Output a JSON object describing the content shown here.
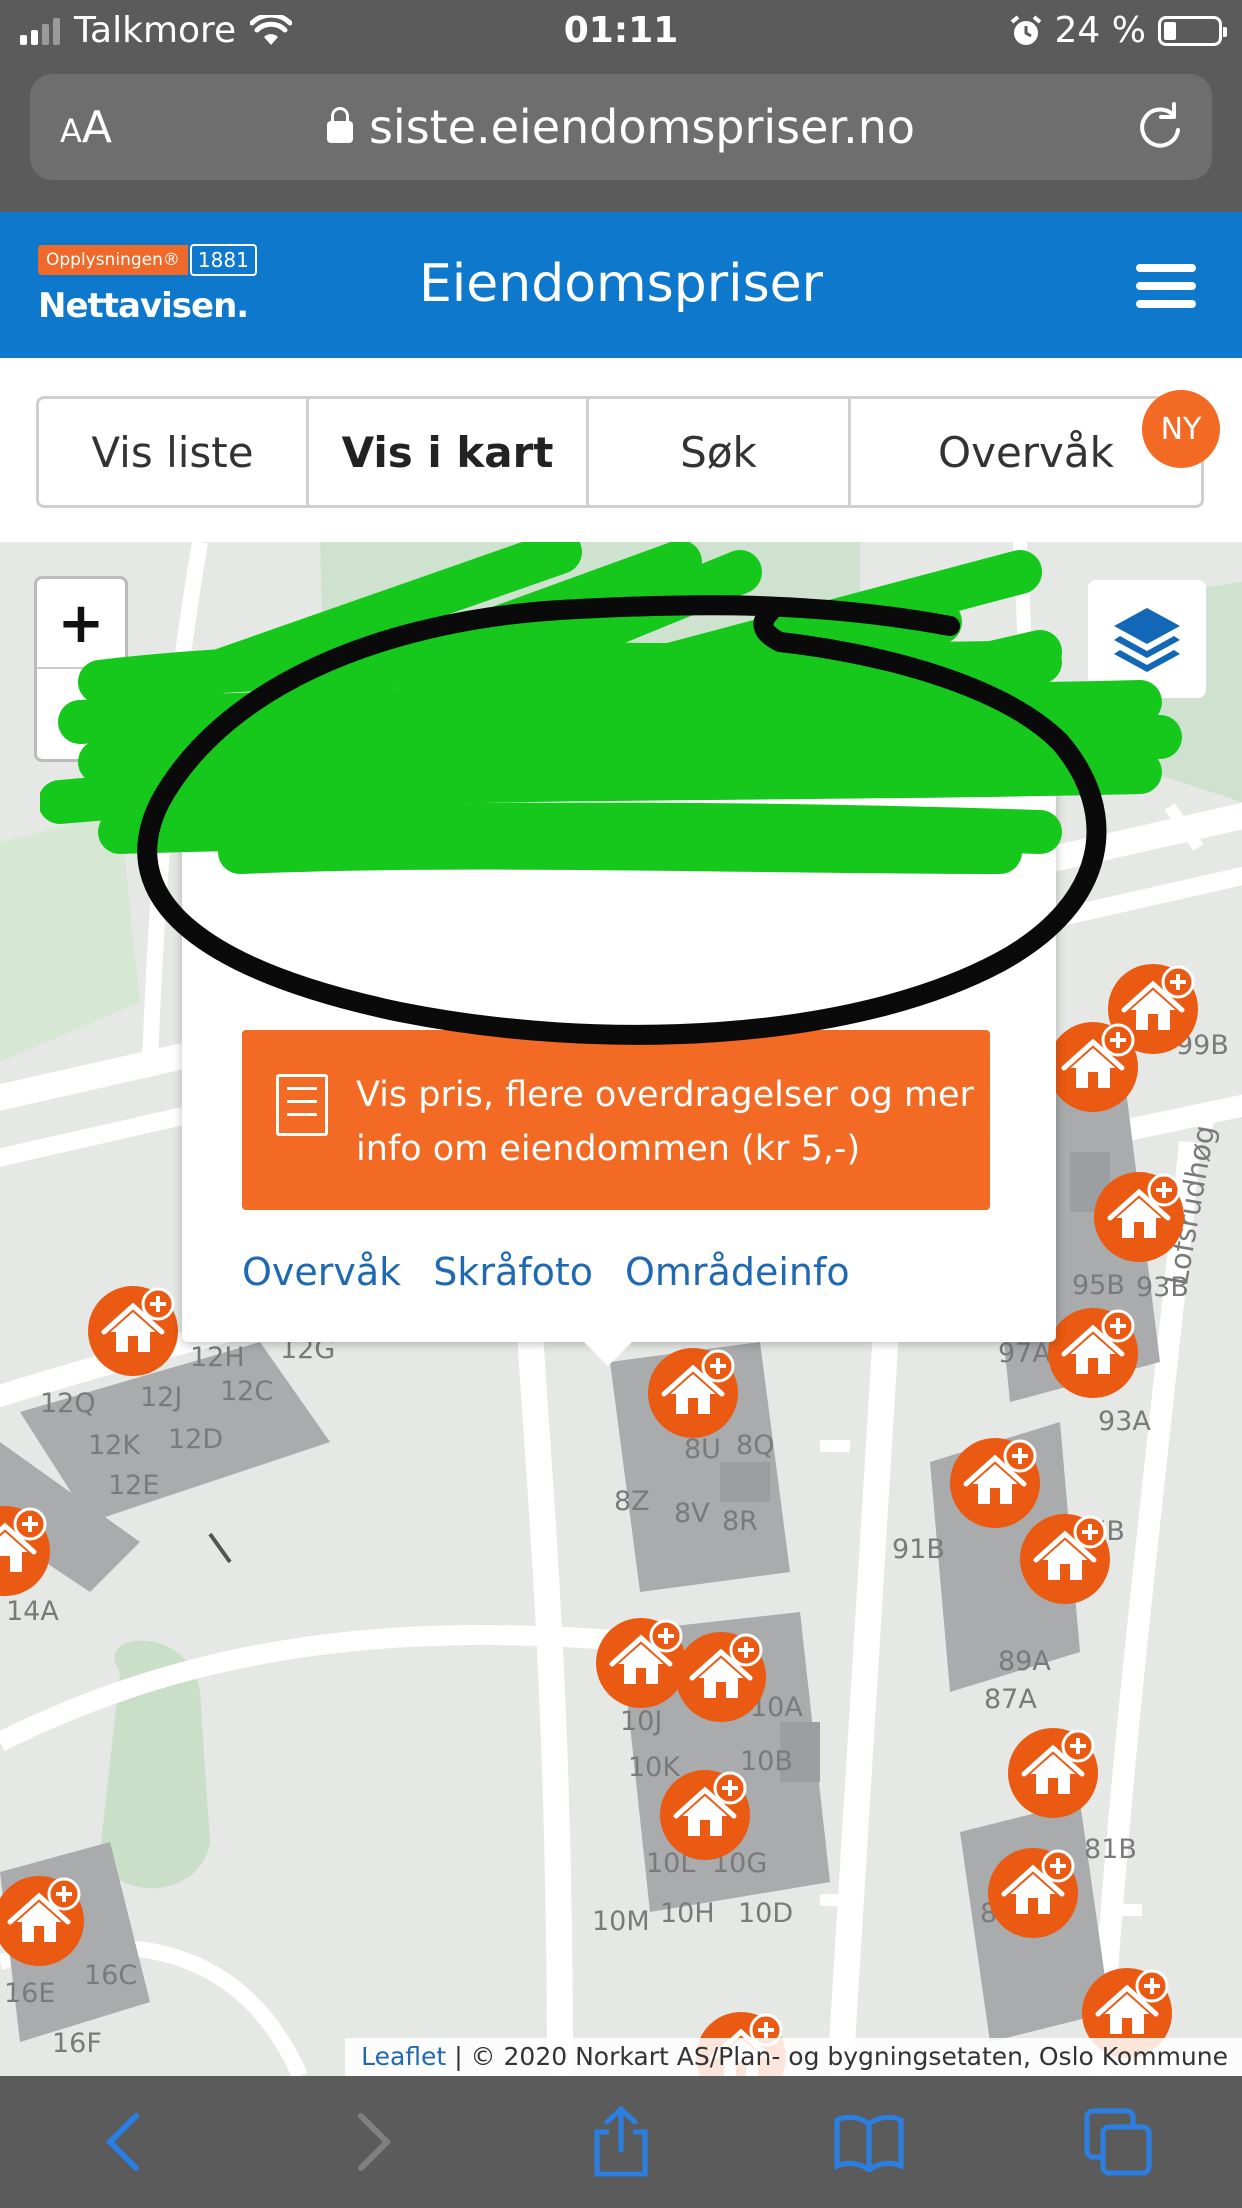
{
  "status_bar": {
    "carrier": "Talkmore",
    "time": "01:11",
    "battery": "24 %"
  },
  "browser": {
    "text_size_label": "AA",
    "url": "siste.eiendomspriser.no"
  },
  "site": {
    "logo_brand_1881": "Opplysningen® 1881",
    "logo_opplysningen": "Opplysningen®",
    "logo_1881": "1881",
    "logo_nettavisen": "Nettavisen.",
    "title": "Eiendomspriser"
  },
  "tabs": [
    {
      "label": "Vis liste"
    },
    {
      "label": "Vis i kart"
    },
    {
      "label": "Søk"
    },
    {
      "label": "Overvåk"
    }
  ],
  "ny_badge": "NY",
  "map": {
    "zoom_in": "+",
    "zoom_out": "−",
    "popup": {
      "buy_button": "Vis pris, flere overdragelser og mer info om eiendommen (kr 5,-)",
      "links": [
        "Overvåk",
        "Skråfoto",
        "Områdeinfo"
      ]
    },
    "building_labels": [
      "12H",
      "12G",
      "12C",
      "12Q",
      "12J",
      "12K",
      "12D",
      "12E",
      "14A",
      "8U",
      "8Q",
      "8Z",
      "8V",
      "8R",
      "10J",
      "10A",
      "10K",
      "10B",
      "10L",
      "10G",
      "10M",
      "10H",
      "10D",
      "16E",
      "16C",
      "16F",
      "95B",
      "93B",
      "97A",
      "93A",
      "91B",
      "87B",
      "89A",
      "87A",
      "81B",
      "85A",
      "99B",
      "Lofsrudhøg"
    ],
    "attribution_link": "Leaflet",
    "attribution_text": "| © 2020 Norkart AS/Plan- og bygningsetaten, Oslo Kommune"
  },
  "colors": {
    "header_blue": "#0e78cc",
    "accent_orange": "#f36a24",
    "link_blue": "#1f69b3"
  }
}
